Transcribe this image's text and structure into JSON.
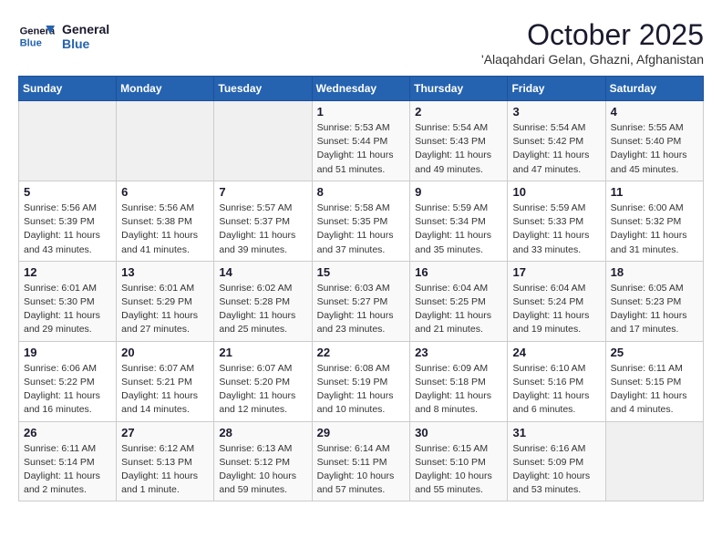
{
  "header": {
    "logo_line1": "General",
    "logo_line2": "Blue",
    "month": "October 2025",
    "location": "'Alaqahdari Gelan, Ghazni, Afghanistan"
  },
  "weekdays": [
    "Sunday",
    "Monday",
    "Tuesday",
    "Wednesday",
    "Thursday",
    "Friday",
    "Saturday"
  ],
  "weeks": [
    [
      {
        "day": "",
        "info": ""
      },
      {
        "day": "",
        "info": ""
      },
      {
        "day": "",
        "info": ""
      },
      {
        "day": "1",
        "info": "Sunrise: 5:53 AM\nSunset: 5:44 PM\nDaylight: 11 hours\nand 51 minutes."
      },
      {
        "day": "2",
        "info": "Sunrise: 5:54 AM\nSunset: 5:43 PM\nDaylight: 11 hours\nand 49 minutes."
      },
      {
        "day": "3",
        "info": "Sunrise: 5:54 AM\nSunset: 5:42 PM\nDaylight: 11 hours\nand 47 minutes."
      },
      {
        "day": "4",
        "info": "Sunrise: 5:55 AM\nSunset: 5:40 PM\nDaylight: 11 hours\nand 45 minutes."
      }
    ],
    [
      {
        "day": "5",
        "info": "Sunrise: 5:56 AM\nSunset: 5:39 PM\nDaylight: 11 hours\nand 43 minutes."
      },
      {
        "day": "6",
        "info": "Sunrise: 5:56 AM\nSunset: 5:38 PM\nDaylight: 11 hours\nand 41 minutes."
      },
      {
        "day": "7",
        "info": "Sunrise: 5:57 AM\nSunset: 5:37 PM\nDaylight: 11 hours\nand 39 minutes."
      },
      {
        "day": "8",
        "info": "Sunrise: 5:58 AM\nSunset: 5:35 PM\nDaylight: 11 hours\nand 37 minutes."
      },
      {
        "day": "9",
        "info": "Sunrise: 5:59 AM\nSunset: 5:34 PM\nDaylight: 11 hours\nand 35 minutes."
      },
      {
        "day": "10",
        "info": "Sunrise: 5:59 AM\nSunset: 5:33 PM\nDaylight: 11 hours\nand 33 minutes."
      },
      {
        "day": "11",
        "info": "Sunrise: 6:00 AM\nSunset: 5:32 PM\nDaylight: 11 hours\nand 31 minutes."
      }
    ],
    [
      {
        "day": "12",
        "info": "Sunrise: 6:01 AM\nSunset: 5:30 PM\nDaylight: 11 hours\nand 29 minutes."
      },
      {
        "day": "13",
        "info": "Sunrise: 6:01 AM\nSunset: 5:29 PM\nDaylight: 11 hours\nand 27 minutes."
      },
      {
        "day": "14",
        "info": "Sunrise: 6:02 AM\nSunset: 5:28 PM\nDaylight: 11 hours\nand 25 minutes."
      },
      {
        "day": "15",
        "info": "Sunrise: 6:03 AM\nSunset: 5:27 PM\nDaylight: 11 hours\nand 23 minutes."
      },
      {
        "day": "16",
        "info": "Sunrise: 6:04 AM\nSunset: 5:25 PM\nDaylight: 11 hours\nand 21 minutes."
      },
      {
        "day": "17",
        "info": "Sunrise: 6:04 AM\nSunset: 5:24 PM\nDaylight: 11 hours\nand 19 minutes."
      },
      {
        "day": "18",
        "info": "Sunrise: 6:05 AM\nSunset: 5:23 PM\nDaylight: 11 hours\nand 17 minutes."
      }
    ],
    [
      {
        "day": "19",
        "info": "Sunrise: 6:06 AM\nSunset: 5:22 PM\nDaylight: 11 hours\nand 16 minutes."
      },
      {
        "day": "20",
        "info": "Sunrise: 6:07 AM\nSunset: 5:21 PM\nDaylight: 11 hours\nand 14 minutes."
      },
      {
        "day": "21",
        "info": "Sunrise: 6:07 AM\nSunset: 5:20 PM\nDaylight: 11 hours\nand 12 minutes."
      },
      {
        "day": "22",
        "info": "Sunrise: 6:08 AM\nSunset: 5:19 PM\nDaylight: 11 hours\nand 10 minutes."
      },
      {
        "day": "23",
        "info": "Sunrise: 6:09 AM\nSunset: 5:18 PM\nDaylight: 11 hours\nand 8 minutes."
      },
      {
        "day": "24",
        "info": "Sunrise: 6:10 AM\nSunset: 5:16 PM\nDaylight: 11 hours\nand 6 minutes."
      },
      {
        "day": "25",
        "info": "Sunrise: 6:11 AM\nSunset: 5:15 PM\nDaylight: 11 hours\nand 4 minutes."
      }
    ],
    [
      {
        "day": "26",
        "info": "Sunrise: 6:11 AM\nSunset: 5:14 PM\nDaylight: 11 hours\nand 2 minutes."
      },
      {
        "day": "27",
        "info": "Sunrise: 6:12 AM\nSunset: 5:13 PM\nDaylight: 11 hours\nand 1 minute."
      },
      {
        "day": "28",
        "info": "Sunrise: 6:13 AM\nSunset: 5:12 PM\nDaylight: 10 hours\nand 59 minutes."
      },
      {
        "day": "29",
        "info": "Sunrise: 6:14 AM\nSunset: 5:11 PM\nDaylight: 10 hours\nand 57 minutes."
      },
      {
        "day": "30",
        "info": "Sunrise: 6:15 AM\nSunset: 5:10 PM\nDaylight: 10 hours\nand 55 minutes."
      },
      {
        "day": "31",
        "info": "Sunrise: 6:16 AM\nSunset: 5:09 PM\nDaylight: 10 hours\nand 53 minutes."
      },
      {
        "day": "",
        "info": ""
      }
    ]
  ]
}
